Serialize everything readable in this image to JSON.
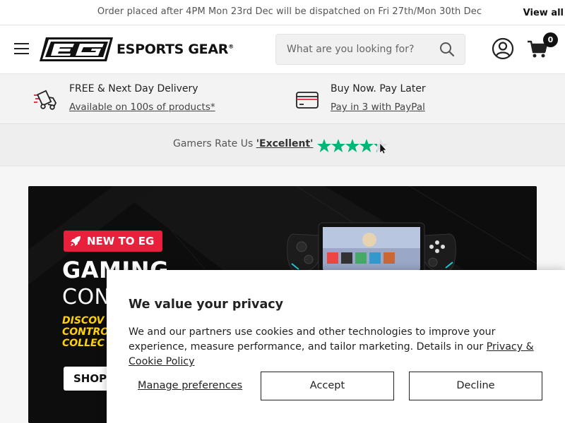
{
  "announcement": {
    "text": "Order placed after 4PM Mon 23rd Dec will be dispatched on Fri 27th/Mon 30th Dec",
    "link": "View all"
  },
  "header": {
    "logo_text": "ESPORTS GEAR",
    "logo_mark": "EG",
    "search_placeholder": "What are you looking for?",
    "cart_count": "0"
  },
  "usp": [
    {
      "title": "FREE & Next Day Delivery",
      "link": "Available on 100s of products*",
      "icon": "delivery-truck-icon"
    },
    {
      "title": "Buy Now. Pay Later",
      "link": "Pay in 3 with PayPal",
      "icon": "credit-card-icon"
    }
  ],
  "rating": {
    "prefix": "Gamers Rate Us ",
    "label": "'Excellent'",
    "stars": 4.5,
    "star_color": "#00b67a"
  },
  "hero": {
    "badge": "NEW TO EG",
    "title_line1": "GAMING",
    "title_line2": "CON",
    "subtitle": "DISCOV\nCONTRO\nCOLLEC",
    "cta": "SHOP",
    "badge_color": "#e8203c",
    "subtitle_color": "#ffd400"
  },
  "cookie": {
    "title": "We value your privacy",
    "body": "We and our partners use cookies and other technologies to improve your experience, measure performance, and tailor marketing. Details in our ",
    "policy_link": "Privacy & Cookie Policy",
    "manage": "Manage preferences",
    "accept": "Accept",
    "decline": "Decline"
  }
}
